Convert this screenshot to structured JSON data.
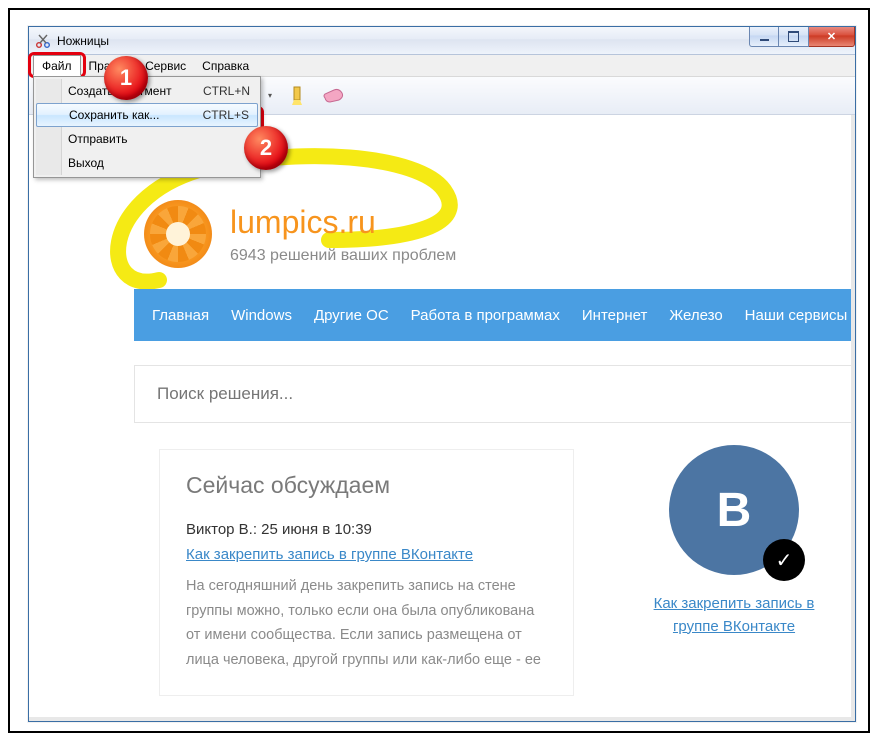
{
  "window": {
    "title": "Ножницы"
  },
  "menubar": [
    "Файл",
    "Правка",
    "Сервис",
    "Справка"
  ],
  "dropdown": {
    "items": [
      {
        "label": "Создать фрагмент",
        "shortcut": "CTRL+N"
      },
      {
        "label": "Сохранить как...",
        "shortcut": "CTRL+S"
      },
      {
        "label": "Отправить",
        "shortcut": ""
      },
      {
        "label": "Выход",
        "shortcut": ""
      }
    ],
    "highlighted_index": 1
  },
  "callouts": {
    "file_menu": "1",
    "save_as": "2"
  },
  "page": {
    "site_title": "lumpics.ru",
    "site_subtitle": "6943 решений ваших проблем",
    "nav": [
      "Главная",
      "Windows",
      "Другие ОС",
      "Работа в программах",
      "Интернет",
      "Железо",
      "Наши сервисы"
    ],
    "search_placeholder": "Поиск решения...",
    "card": {
      "heading": "Сейчас обсуждаем",
      "author_line": "Виктор В.: 25 июня в 10:39",
      "link": "Как закрепить запись в группе ВКонтакте",
      "body": "На сегодняшний день закрепить запись на стене группы можно, только если она была опубликована от имени сообщества. Если запись размещена от лица человека, другой группы или как-либо еще - ее"
    },
    "vk": {
      "letter": "В",
      "caption": "Как закрепить запись в группе ВКонтакте"
    }
  }
}
